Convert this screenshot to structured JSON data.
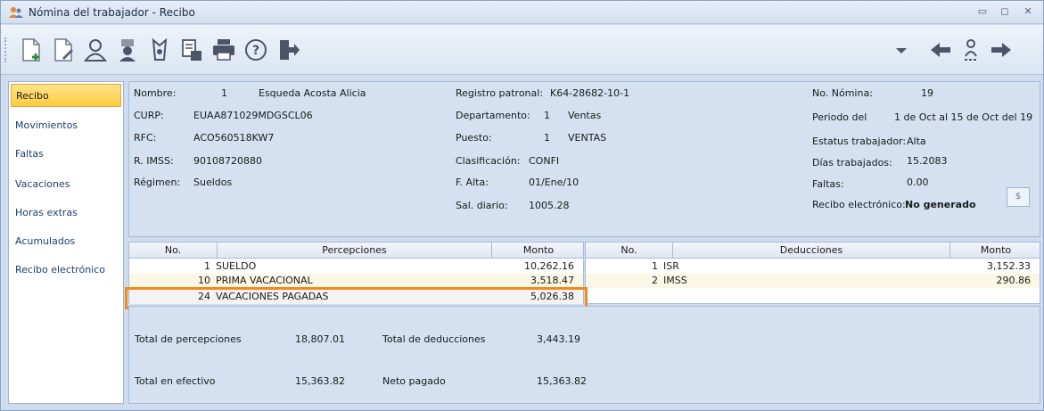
{
  "window": {
    "title": "Nómina del trabajador - Recibo",
    "controls": [
      "▭",
      "◻",
      "✕"
    ]
  },
  "toolbar": {
    "icons": [
      "new-document-icon",
      "edit-document-icon",
      "employee-icon",
      "payroll-person-icon",
      "tax-icon",
      "calculate-icon",
      "print-icon",
      "help-icon",
      "exit-icon",
      "dropdown-icon",
      "back-arrow-icon",
      "employee-nav-icon",
      "forward-arrow-icon"
    ]
  },
  "sidebar": {
    "items": [
      {
        "label": "Recibo",
        "active": true
      },
      {
        "label": "Movimientos"
      },
      {
        "label": "Faltas"
      },
      {
        "label": "Vacaciones"
      },
      {
        "label": "Horas extras"
      },
      {
        "label": "Acumulados"
      },
      {
        "label": "Recibo electrónico"
      }
    ]
  },
  "employee": {
    "nombre_label": "Nombre:",
    "nombre_num": "1",
    "nombre": "Esqueda Acosta Alicia",
    "curp_label": "CURP:",
    "curp": "EUAA871029MDGSCL06",
    "rfc_label": "RFC:",
    "rfc": "ACO560518KW7",
    "imss_label": "R. IMSS:",
    "imss": "90108720880",
    "regimen_label": "Régimen:",
    "regimen": "Sueldos",
    "registro_label": "Registro patronal:",
    "registro": "K64-28682-10-1",
    "depto_label": "Departamento:",
    "depto_num": "1",
    "depto": "Ventas",
    "puesto_label": "Puesto:",
    "puesto_num": "1",
    "puesto": "VENTAS",
    "clasif_label": "Clasificación:",
    "clasif": "CONFI",
    "falta_label": "F. Alta:",
    "falta": "01/Ene/10",
    "sal_label": "Sal. diario:",
    "sal": "1005.28",
    "nomina_label": "No. Nómina:",
    "nomina": "19",
    "periodo_label": "Periodo del",
    "periodo": "1 de Oct al 15 de Oct del 19",
    "estatus_label": "Estatus trabajador:",
    "estatus": "Alta",
    "dias_label": "Días trabajados:",
    "dias": "15.2083",
    "faltas_label": "Faltas:",
    "faltas": "0.00",
    "recibo_label": "Recibo electrónico:",
    "recibo": "No generado",
    "pdf_button": "$"
  },
  "percepciones": {
    "headers": [
      "No.",
      "Percepciones",
      "Monto"
    ],
    "rows": [
      {
        "no": "1",
        "concepto": "SUELDO",
        "monto": "10,262.16"
      },
      {
        "no": "10",
        "concepto": "PRIMA VACACIONAL",
        "monto": "3,518.47"
      },
      {
        "no": "24",
        "concepto": "VACACIONES PAGADAS",
        "monto": "5,026.38"
      }
    ]
  },
  "deducciones": {
    "headers": [
      "No.",
      "Deducciones",
      "Monto"
    ],
    "rows": [
      {
        "no": "1",
        "concepto": "ISR",
        "monto": "3,152.33"
      },
      {
        "no": "2",
        "concepto": "IMSS",
        "monto": "290.86"
      }
    ]
  },
  "totals": {
    "tot_percepciones_label": "Total de percepciones",
    "tot_percepciones": "18,807.01",
    "tot_deducciones_label": "Total de deducciones",
    "tot_deducciones": "3,443.19",
    "tot_efectivo_label": "Total en efectivo",
    "tot_efectivo": "15,363.82",
    "neto_label": "Neto pagado",
    "neto": "15,363.82"
  },
  "colors": {
    "highlight": "#f08a1c",
    "active_tab": "#ffcb3f"
  }
}
